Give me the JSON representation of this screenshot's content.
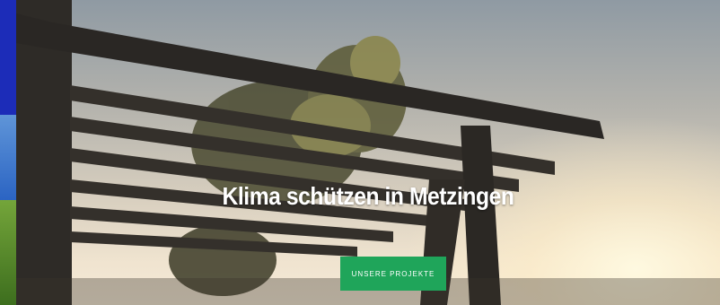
{
  "hero": {
    "title": "Klima schützen in Metzingen",
    "cta_label": "UNSERE PROJEKTE"
  },
  "colors": {
    "cta": "#1fa55a",
    "left_strip_top": "#1c2cb8"
  }
}
